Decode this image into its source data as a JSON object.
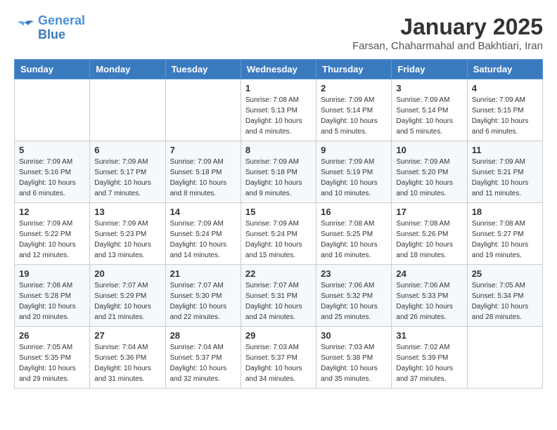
{
  "header": {
    "logo_line1": "General",
    "logo_line2": "Blue",
    "month_title": "January 2025",
    "subtitle": "Farsan, Chaharmahal and Bakhtiari, Iran"
  },
  "weekdays": [
    "Sunday",
    "Monday",
    "Tuesday",
    "Wednesday",
    "Thursday",
    "Friday",
    "Saturday"
  ],
  "weeks": [
    [
      {
        "day": "",
        "info": ""
      },
      {
        "day": "",
        "info": ""
      },
      {
        "day": "",
        "info": ""
      },
      {
        "day": "1",
        "info": "Sunrise: 7:08 AM\nSunset: 5:13 PM\nDaylight: 10 hours\nand 4 minutes."
      },
      {
        "day": "2",
        "info": "Sunrise: 7:09 AM\nSunset: 5:14 PM\nDaylight: 10 hours\nand 5 minutes."
      },
      {
        "day": "3",
        "info": "Sunrise: 7:09 AM\nSunset: 5:14 PM\nDaylight: 10 hours\nand 5 minutes."
      },
      {
        "day": "4",
        "info": "Sunrise: 7:09 AM\nSunset: 5:15 PM\nDaylight: 10 hours\nand 6 minutes."
      }
    ],
    [
      {
        "day": "5",
        "info": "Sunrise: 7:09 AM\nSunset: 5:16 PM\nDaylight: 10 hours\nand 6 minutes."
      },
      {
        "day": "6",
        "info": "Sunrise: 7:09 AM\nSunset: 5:17 PM\nDaylight: 10 hours\nand 7 minutes."
      },
      {
        "day": "7",
        "info": "Sunrise: 7:09 AM\nSunset: 5:18 PM\nDaylight: 10 hours\nand 8 minutes."
      },
      {
        "day": "8",
        "info": "Sunrise: 7:09 AM\nSunset: 5:18 PM\nDaylight: 10 hours\nand 9 minutes."
      },
      {
        "day": "9",
        "info": "Sunrise: 7:09 AM\nSunset: 5:19 PM\nDaylight: 10 hours\nand 10 minutes."
      },
      {
        "day": "10",
        "info": "Sunrise: 7:09 AM\nSunset: 5:20 PM\nDaylight: 10 hours\nand 10 minutes."
      },
      {
        "day": "11",
        "info": "Sunrise: 7:09 AM\nSunset: 5:21 PM\nDaylight: 10 hours\nand 11 minutes."
      }
    ],
    [
      {
        "day": "12",
        "info": "Sunrise: 7:09 AM\nSunset: 5:22 PM\nDaylight: 10 hours\nand 12 minutes."
      },
      {
        "day": "13",
        "info": "Sunrise: 7:09 AM\nSunset: 5:23 PM\nDaylight: 10 hours\nand 13 minutes."
      },
      {
        "day": "14",
        "info": "Sunrise: 7:09 AM\nSunset: 5:24 PM\nDaylight: 10 hours\nand 14 minutes."
      },
      {
        "day": "15",
        "info": "Sunrise: 7:09 AM\nSunset: 5:24 PM\nDaylight: 10 hours\nand 15 minutes."
      },
      {
        "day": "16",
        "info": "Sunrise: 7:08 AM\nSunset: 5:25 PM\nDaylight: 10 hours\nand 16 minutes."
      },
      {
        "day": "17",
        "info": "Sunrise: 7:08 AM\nSunset: 5:26 PM\nDaylight: 10 hours\nand 18 minutes."
      },
      {
        "day": "18",
        "info": "Sunrise: 7:08 AM\nSunset: 5:27 PM\nDaylight: 10 hours\nand 19 minutes."
      }
    ],
    [
      {
        "day": "19",
        "info": "Sunrise: 7:08 AM\nSunset: 5:28 PM\nDaylight: 10 hours\nand 20 minutes."
      },
      {
        "day": "20",
        "info": "Sunrise: 7:07 AM\nSunset: 5:29 PM\nDaylight: 10 hours\nand 21 minutes."
      },
      {
        "day": "21",
        "info": "Sunrise: 7:07 AM\nSunset: 5:30 PM\nDaylight: 10 hours\nand 22 minutes."
      },
      {
        "day": "22",
        "info": "Sunrise: 7:07 AM\nSunset: 5:31 PM\nDaylight: 10 hours\nand 24 minutes."
      },
      {
        "day": "23",
        "info": "Sunrise: 7:06 AM\nSunset: 5:32 PM\nDaylight: 10 hours\nand 25 minutes."
      },
      {
        "day": "24",
        "info": "Sunrise: 7:06 AM\nSunset: 5:33 PM\nDaylight: 10 hours\nand 26 minutes."
      },
      {
        "day": "25",
        "info": "Sunrise: 7:05 AM\nSunset: 5:34 PM\nDaylight: 10 hours\nand 28 minutes."
      }
    ],
    [
      {
        "day": "26",
        "info": "Sunrise: 7:05 AM\nSunset: 5:35 PM\nDaylight: 10 hours\nand 29 minutes."
      },
      {
        "day": "27",
        "info": "Sunrise: 7:04 AM\nSunset: 5:36 PM\nDaylight: 10 hours\nand 31 minutes."
      },
      {
        "day": "28",
        "info": "Sunrise: 7:04 AM\nSunset: 5:37 PM\nDaylight: 10 hours\nand 32 minutes."
      },
      {
        "day": "29",
        "info": "Sunrise: 7:03 AM\nSunset: 5:37 PM\nDaylight: 10 hours\nand 34 minutes."
      },
      {
        "day": "30",
        "info": "Sunrise: 7:03 AM\nSunset: 5:38 PM\nDaylight: 10 hours\nand 35 minutes."
      },
      {
        "day": "31",
        "info": "Sunrise: 7:02 AM\nSunset: 5:39 PM\nDaylight: 10 hours\nand 37 minutes."
      },
      {
        "day": "",
        "info": ""
      }
    ]
  ]
}
